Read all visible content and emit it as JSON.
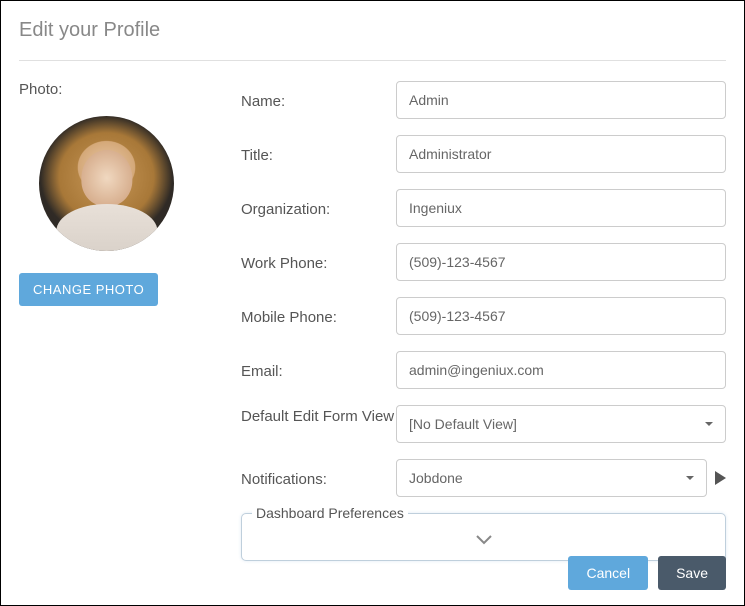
{
  "page_title": "Edit your Profile",
  "photo": {
    "label": "Photo:",
    "change_button": "CHANGE PHOTO"
  },
  "fields": {
    "name": {
      "label": "Name:",
      "value": "Admin"
    },
    "title": {
      "label": "Title:",
      "value": "Administrator"
    },
    "organization": {
      "label": "Organization:",
      "value": "Ingeniux"
    },
    "work_phone": {
      "label": "Work Phone:",
      "value": "(509)-123-4567"
    },
    "mobile_phone": {
      "label": "Mobile Phone:",
      "value": "(509)-123-4567"
    },
    "email": {
      "label": "Email:",
      "value": "admin@ingeniux.com"
    },
    "default_view": {
      "label": "Default Edit Form View",
      "selected": "[No Default View]"
    },
    "notifications": {
      "label": "Notifications:",
      "selected": "Jobdone"
    }
  },
  "dashboard_prefs": {
    "legend": "Dashboard Preferences"
  },
  "footer": {
    "cancel": "Cancel",
    "save": "Save"
  }
}
